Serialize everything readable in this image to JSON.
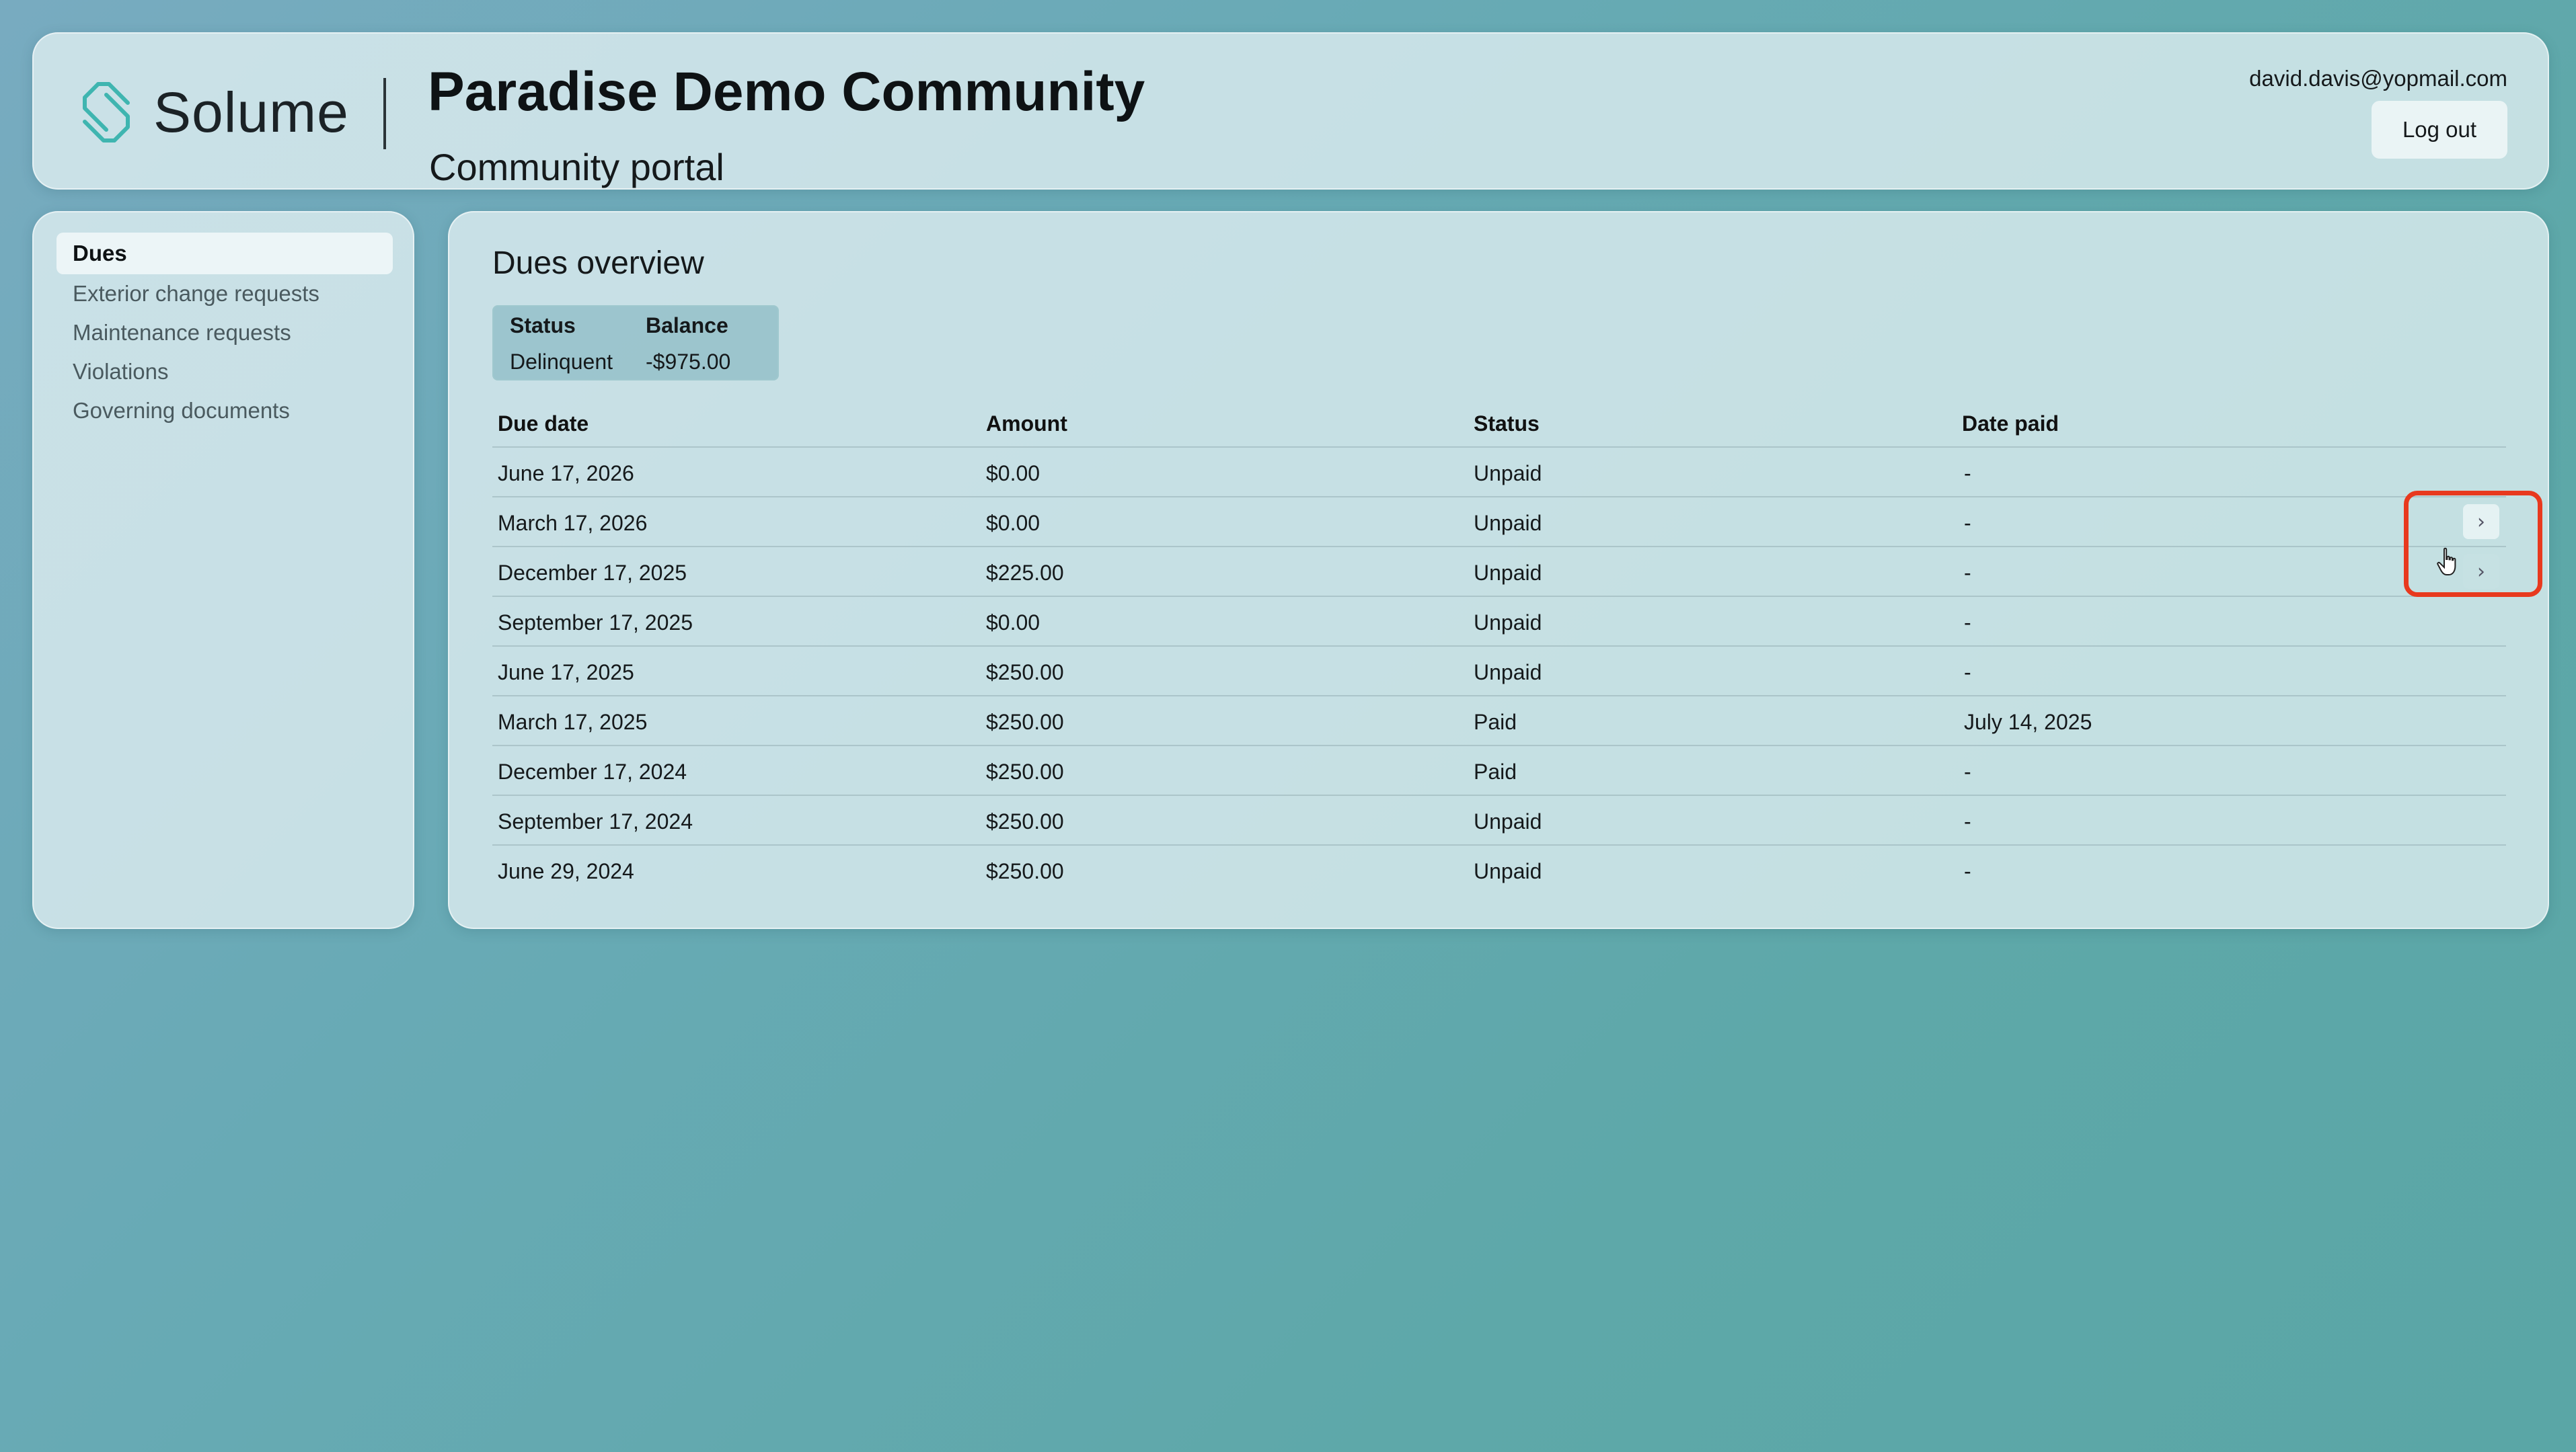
{
  "brand": {
    "name": "Solume",
    "logo_icon": "solume-logo-icon"
  },
  "header": {
    "title": "Paradise Demo Community",
    "subtitle": "Community portal",
    "user_email": "david.davis@yopmail.com",
    "logout_label": "Log out"
  },
  "sidebar": {
    "items": [
      {
        "label": "Dues",
        "active": true
      },
      {
        "label": "Exterior change requests",
        "active": false
      },
      {
        "label": "Maintenance requests",
        "active": false
      },
      {
        "label": "Violations",
        "active": false
      },
      {
        "label": "Governing documents",
        "active": false
      }
    ]
  },
  "main": {
    "title": "Dues overview",
    "summary": {
      "status_header": "Status",
      "balance_header": "Balance",
      "status_value": "Delinquent",
      "balance_value": "-$975.00"
    },
    "table": {
      "columns": [
        "Due date",
        "Amount",
        "Status",
        "Date paid"
      ],
      "rows": [
        {
          "due_date": "June 17, 2026",
          "amount": "$0.00",
          "status": "Unpaid",
          "date_paid": "-"
        },
        {
          "due_date": "March 17, 2026",
          "amount": "$0.00",
          "status": "Unpaid",
          "date_paid": "-",
          "action": "›"
        },
        {
          "due_date": "December 17, 2025",
          "amount": "$225.00",
          "status": "Unpaid",
          "date_paid": "-",
          "action": "›"
        },
        {
          "due_date": "September 17, 2025",
          "amount": "$0.00",
          "status": "Unpaid",
          "date_paid": "-"
        },
        {
          "due_date": "June 17, 2025",
          "amount": "$250.00",
          "status": "Unpaid",
          "date_paid": "-"
        },
        {
          "due_date": "March 17, 2025",
          "amount": "$250.00",
          "status": "Paid",
          "date_paid": "July 14, 2025"
        },
        {
          "due_date": "December 17, 2024",
          "amount": "$250.00",
          "status": "Paid",
          "date_paid": "-"
        },
        {
          "due_date": "September 17, 2024",
          "amount": "$250.00",
          "status": "Unpaid",
          "date_paid": "-"
        },
        {
          "due_date": "June 29, 2024",
          "amount": "$250.00",
          "status": "Unpaid",
          "date_paid": "-"
        }
      ]
    }
  },
  "colors": {
    "highlight": "#e8391e",
    "logo_teal": "#3fb5b0"
  }
}
